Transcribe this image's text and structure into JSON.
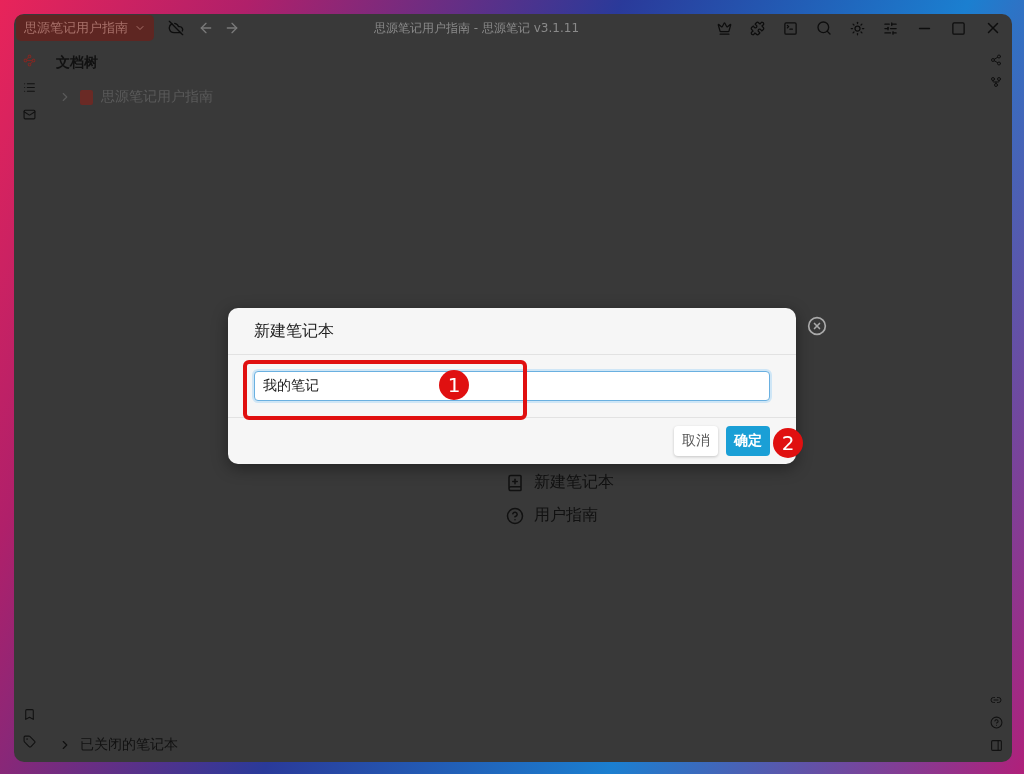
{
  "titlebar": {
    "tab": "思源笔记用户指南",
    "title": "思源笔记用户指南 - 思源笔记 v3.1.11"
  },
  "sidebar": {
    "heading": "文档树",
    "notebooks": [
      {
        "label": "思源笔记用户指南",
        "expanded": false
      }
    ],
    "closed": {
      "label": "已关闭的笔记本",
      "expanded": false
    }
  },
  "main": {
    "actions": [
      {
        "label": "新建笔记本",
        "kind": "notebook"
      },
      {
        "label": "用户指南",
        "kind": "help"
      }
    ]
  },
  "dialog": {
    "title": "新建笔记本",
    "value": "我的笔记",
    "buttons": [
      {
        "label": "取消",
        "kind": "secondary"
      },
      {
        "label": "确定",
        "kind": "primary"
      }
    ]
  },
  "annotations": [
    {
      "number": "1"
    },
    {
      "number": "2"
    }
  ]
}
